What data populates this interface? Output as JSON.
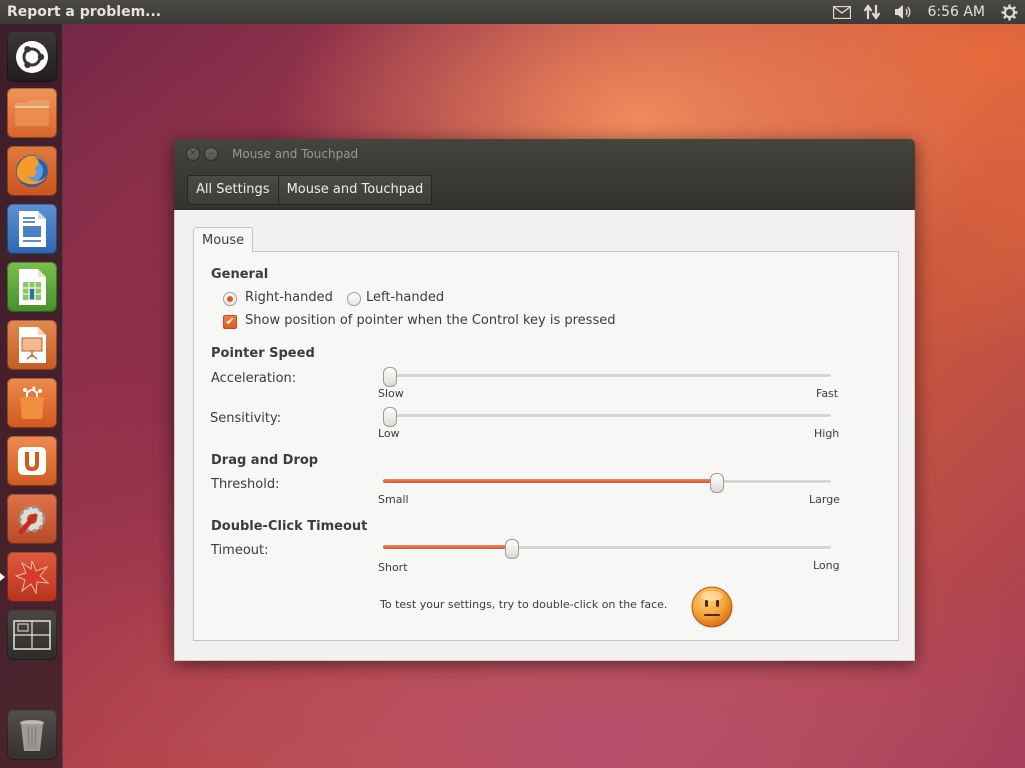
{
  "top_panel": {
    "app_title": "Report a problem...",
    "clock": "6:56 AM",
    "icons": [
      "mail-icon",
      "network-icon",
      "volume-icon",
      "settings-gear-icon"
    ]
  },
  "launcher": {
    "items": [
      "dash-home",
      "files",
      "firefox",
      "libreoffice-writer",
      "libreoffice-calc",
      "libreoffice-impress",
      "software-center",
      "ubuntu-one",
      "system-settings",
      "apport-problem-reporter",
      "workspace-switcher",
      "trash"
    ]
  },
  "window": {
    "title": "Mouse and Touchpad",
    "breadcrumbs": [
      "All Settings",
      "Mouse and Touchpad"
    ],
    "tab": "Mouse",
    "general": {
      "heading": "General",
      "right_handed": "Right-handed",
      "left_handed": "Left-handed",
      "handedness": "right",
      "show_pointer": "Show position of pointer when the Control key is pressed",
      "show_pointer_checked": true
    },
    "pointer_speed": {
      "heading": "Pointer Speed",
      "acceleration": {
        "label": "Acceleration:",
        "min": "Slow",
        "max": "Fast",
        "value": 0.0
      },
      "sensitivity": {
        "label": "Sensitivity:",
        "min": "Low",
        "max": "High",
        "value": 0.0
      }
    },
    "drag_drop": {
      "heading": "Drag and Drop",
      "threshold": {
        "label": "Threshold:",
        "min": "Small",
        "max": "Large",
        "value": 0.75
      }
    },
    "double_click": {
      "heading": "Double-Click Timeout",
      "timeout": {
        "label": "Timeout:",
        "min": "Short",
        "max": "Long",
        "value": 0.28
      }
    },
    "test_text": "To test your settings, try to double-click on the face."
  },
  "colors": {
    "accent": "#dd4814",
    "panel": "#3c3b37"
  }
}
